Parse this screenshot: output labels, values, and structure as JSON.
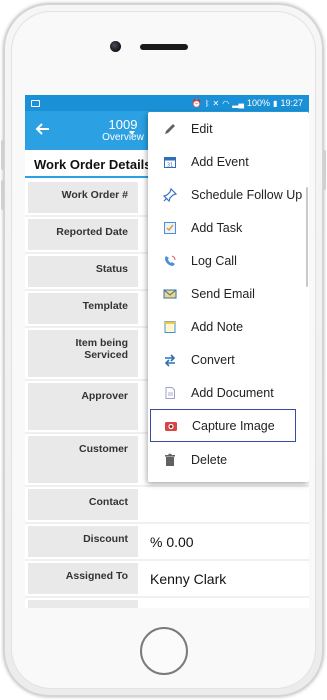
{
  "status_bar": {
    "icons": [
      "image-icon",
      "alarm-icon",
      "bluetooth-icon",
      "mute-icon",
      "wifi-icon",
      "signal-icon"
    ],
    "battery": "100%",
    "time": "19:27"
  },
  "app_bar": {
    "record_number": "1009",
    "view_name": "Overview",
    "back_icon": "back-arrow-icon",
    "accent_color": "#2ba0e2"
  },
  "section": {
    "title": "Work Order Details"
  },
  "fields": [
    {
      "label": "Work Order #",
      "value": ""
    },
    {
      "label": "Reported Date",
      "value": ""
    },
    {
      "label": "Status",
      "value": ""
    },
    {
      "label": "Template",
      "value": ""
    },
    {
      "label": "Item being Serviced",
      "value": ""
    },
    {
      "label": "Approver",
      "value": ""
    },
    {
      "label": "Customer",
      "value": ""
    },
    {
      "label": "Contact",
      "value": ""
    },
    {
      "label": "Discount",
      "value": "% 0.00"
    },
    {
      "label": "Assigned To",
      "value": "Kenny Clark"
    },
    {
      "label": "",
      "value": ""
    }
  ],
  "menu": {
    "items": [
      {
        "label": "Edit",
        "icon": "pencil-icon"
      },
      {
        "label": "Add Event",
        "icon": "calendar-icon"
      },
      {
        "label": "Schedule Follow Up",
        "icon": "pin-icon"
      },
      {
        "label": "Add Task",
        "icon": "task-icon"
      },
      {
        "label": "Log Call",
        "icon": "phone-icon"
      },
      {
        "label": "Send Email",
        "icon": "envelope-icon"
      },
      {
        "label": "Add Note",
        "icon": "note-icon"
      },
      {
        "label": "Convert",
        "icon": "convert-arrows-icon"
      },
      {
        "label": "Add Document",
        "icon": "document-icon"
      },
      {
        "label": "Capture Image",
        "icon": "camera-icon",
        "selected": true
      },
      {
        "label": "Delete",
        "icon": "trash-icon"
      }
    ]
  }
}
